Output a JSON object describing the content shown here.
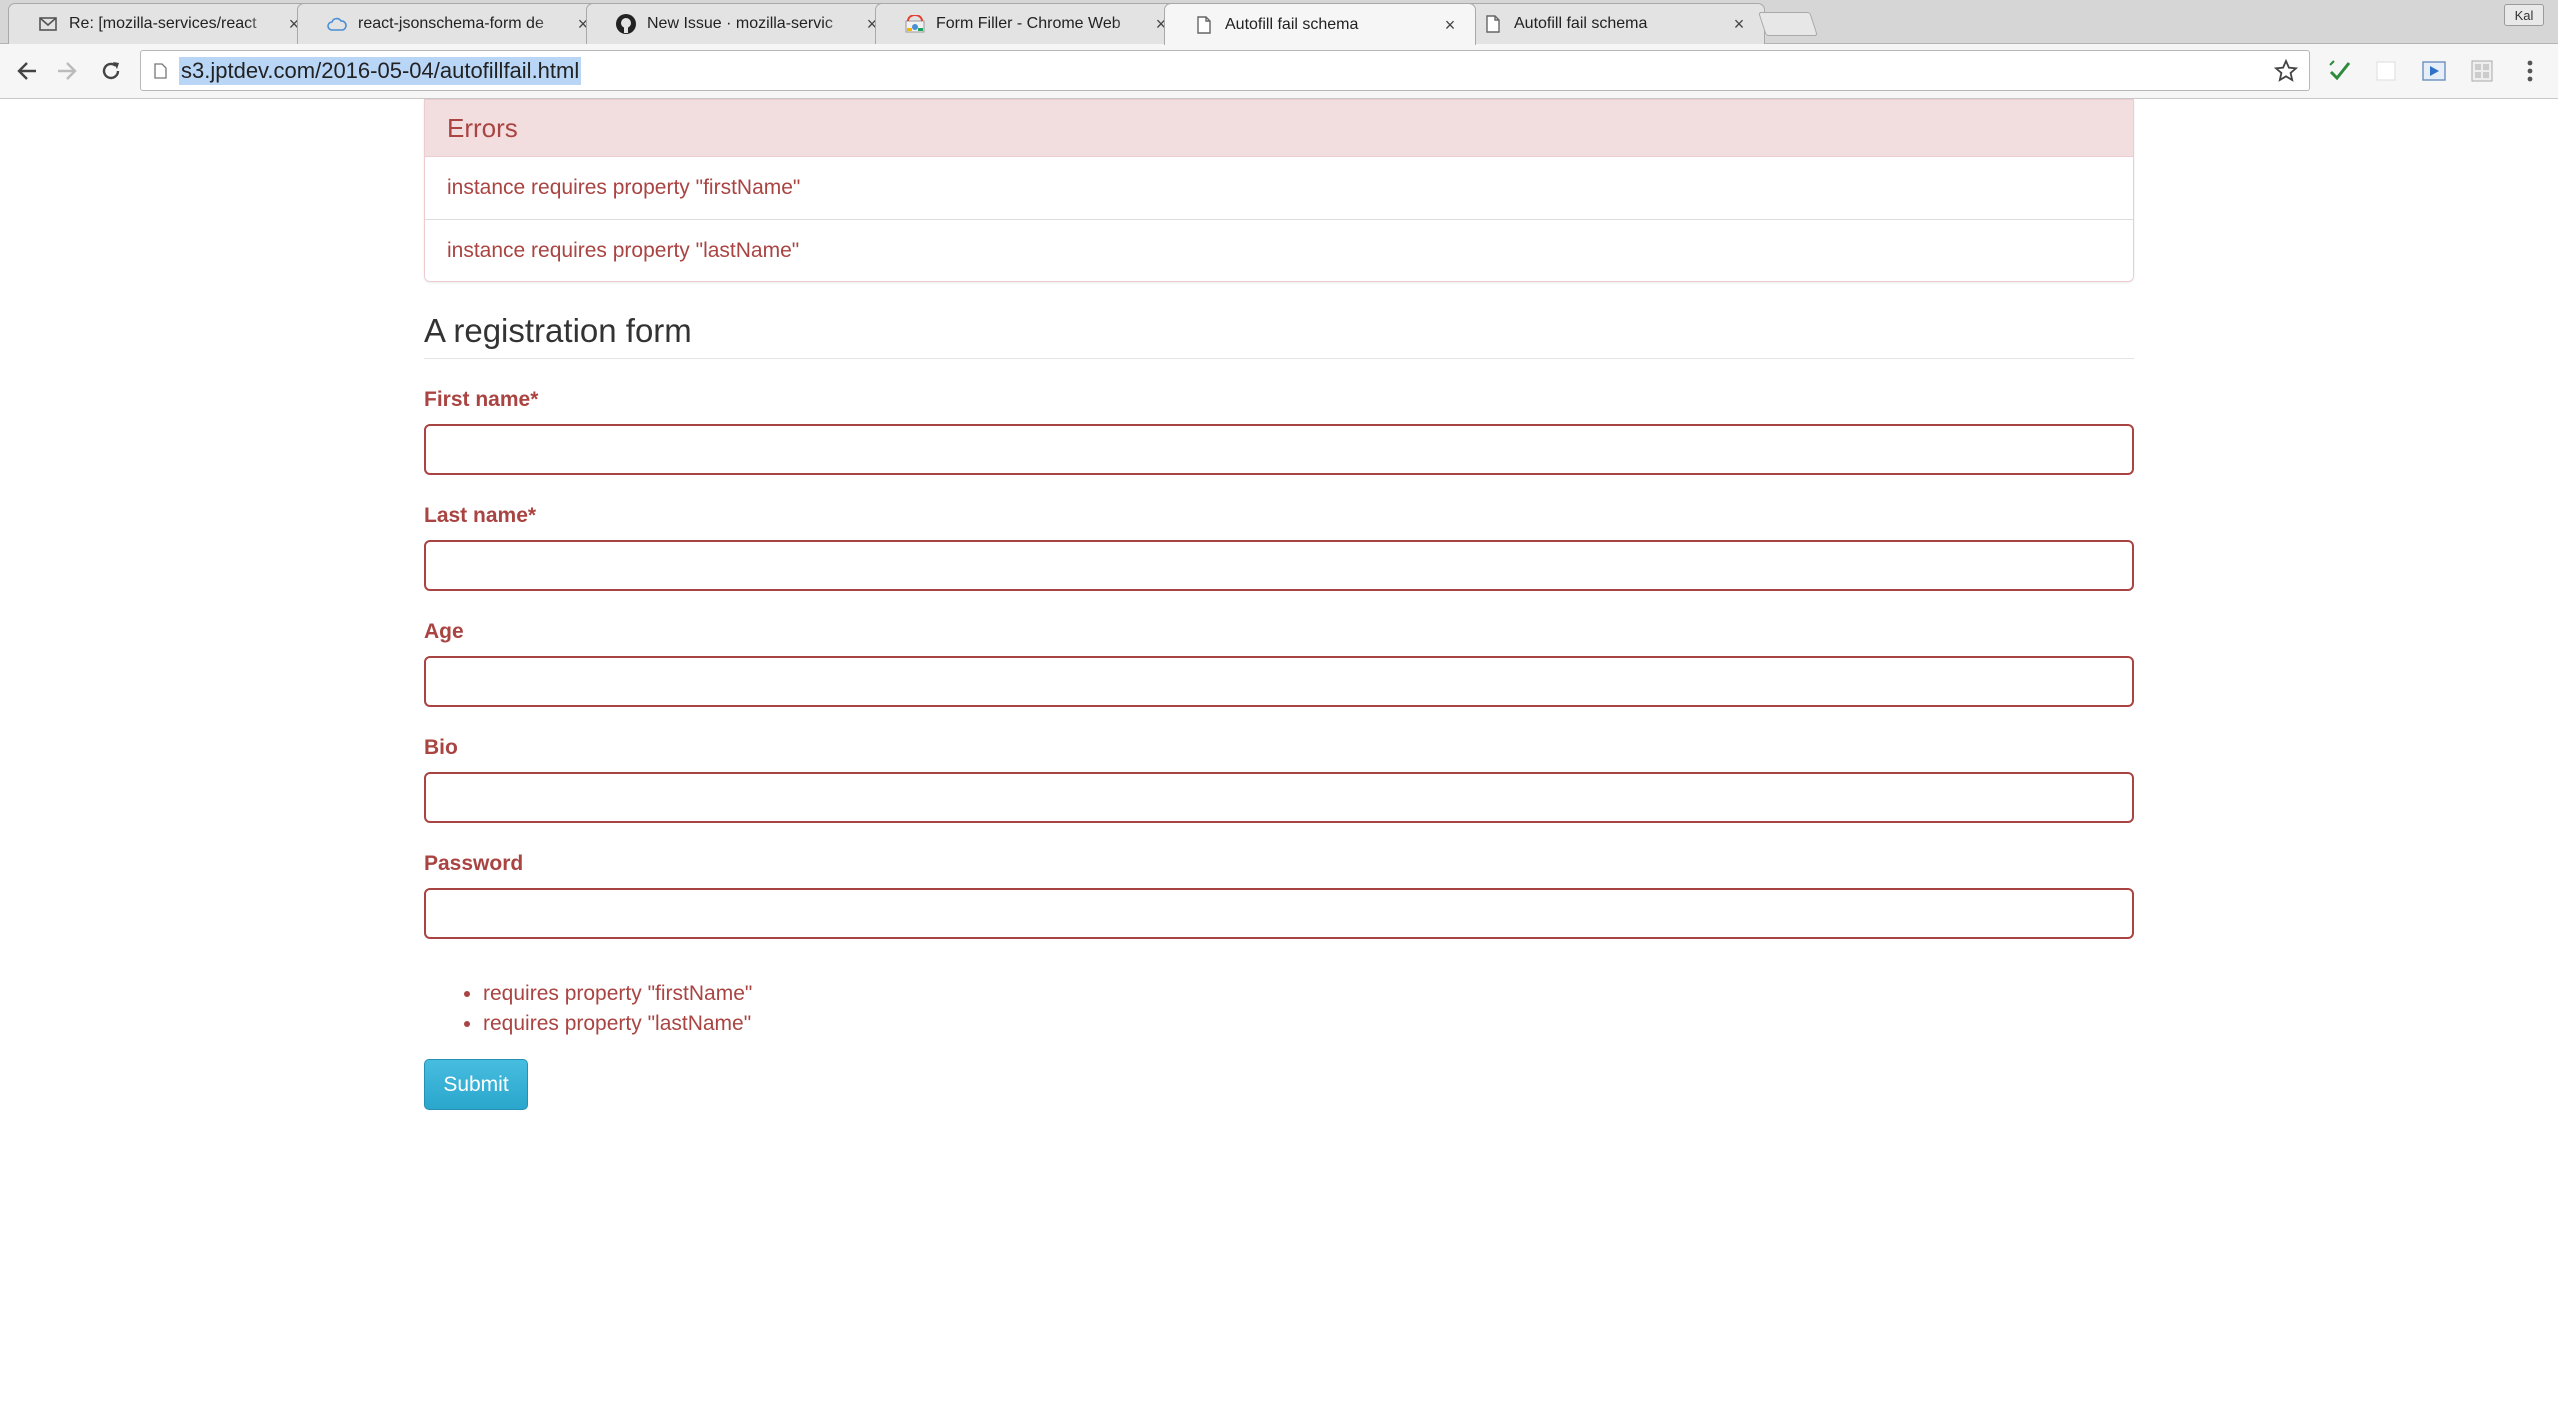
{
  "browser": {
    "tabs": [
      {
        "title": "Re: [mozilla-services/react",
        "icon": "mail-icon",
        "active": false
      },
      {
        "title": "react-jsonschema-form de",
        "icon": "cloud-icon",
        "active": false
      },
      {
        "title": "New Issue · mozilla-servic",
        "icon": "github-icon",
        "active": false
      },
      {
        "title": "Form Filler - Chrome Web",
        "icon": "chrome-store-icon",
        "active": false
      },
      {
        "title": "Autofill fail schema",
        "icon": "page-icon",
        "active": true
      },
      {
        "title": "Autofill fail schema",
        "icon": "page-icon",
        "active": false
      }
    ],
    "tab_close_glyph": "×",
    "profile_label": "Kal",
    "url": "s3.jptdev.com/2016-05-04/autofillfail.html"
  },
  "errors_panel": {
    "heading": "Errors",
    "items": [
      "instance requires property \"firstName\"",
      "instance requires property \"lastName\""
    ]
  },
  "form": {
    "legend": "A registration form",
    "fields": [
      {
        "label": "First name*",
        "value": ""
      },
      {
        "label": "Last name*",
        "value": ""
      },
      {
        "label": "Age",
        "value": ""
      },
      {
        "label": "Bio",
        "value": ""
      },
      {
        "label": "Password",
        "value": ""
      }
    ],
    "field_errors": [
      "requires property \"firstName\"",
      "requires property \"lastName\""
    ],
    "submit_label": "Submit"
  },
  "colors": {
    "error_text": "#a94442",
    "error_bg": "#f2dede",
    "submit_bg": "#35b0d6"
  }
}
